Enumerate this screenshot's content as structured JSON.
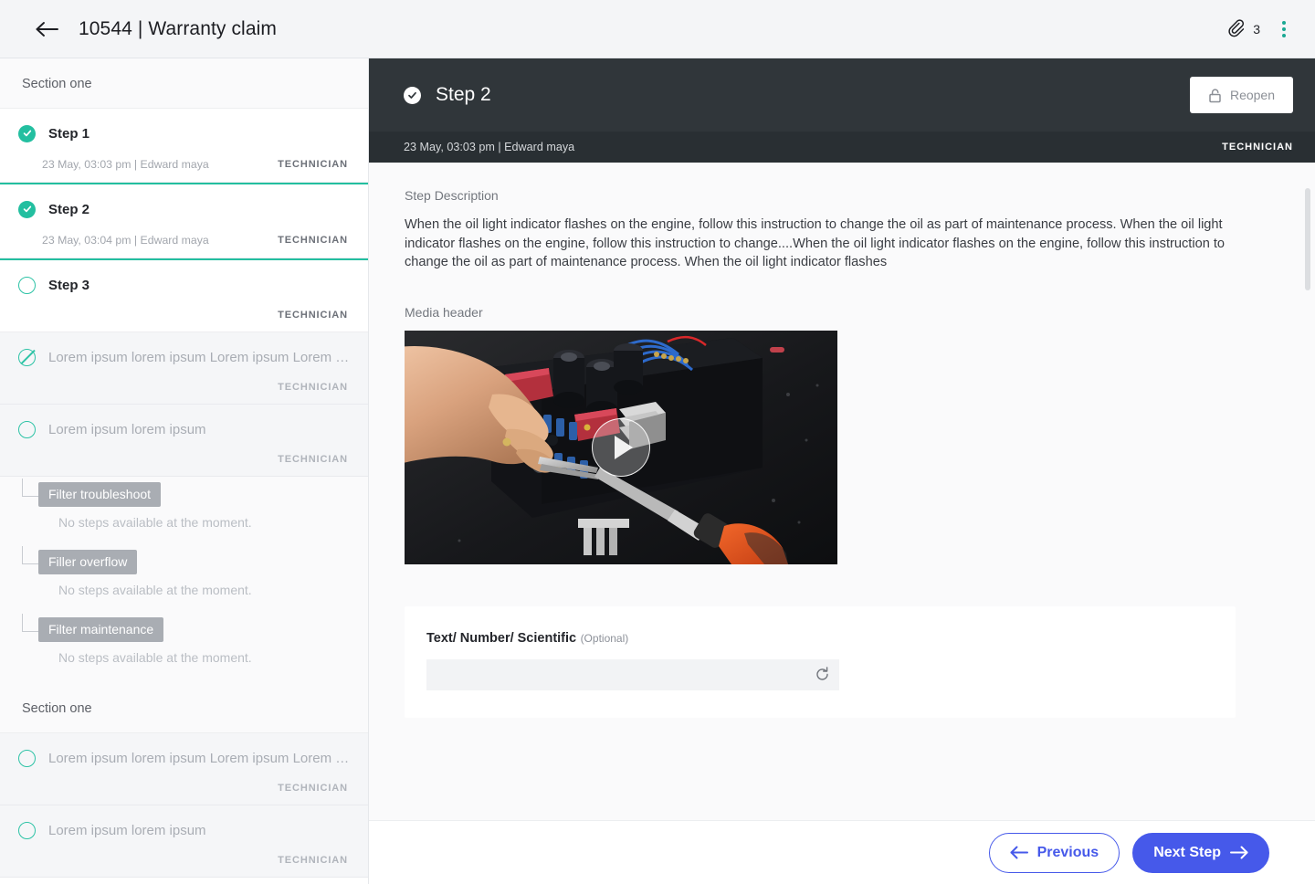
{
  "topbar": {
    "back_icon": "arrow-left-icon",
    "title": "10544 | Warranty claim",
    "attachment_icon": "paperclip-icon",
    "attachment_count": "3",
    "menu_icon": "kebab-menu-icon"
  },
  "sidebar": {
    "sections": [
      {
        "title": "Section one",
        "steps": [
          {
            "status": "done",
            "label": "Step 1",
            "meta": "23 May, 03:03 pm | Edward maya",
            "role": "TECHNICIAN",
            "active": false,
            "muted": false
          },
          {
            "status": "done",
            "label": "Step 2",
            "meta": "23 May, 03:04 pm | Edward maya",
            "role": "TECHNICIAN",
            "active": true,
            "muted": false
          },
          {
            "status": "open",
            "label": "Step 3",
            "meta": "",
            "role": "TECHNICIAN",
            "active": false,
            "muted": false
          },
          {
            "status": "skip",
            "label": "Lorem ipsum lorem ipsum Lorem ipsum Lorem ipsum lor...",
            "meta": "",
            "role": "TECHNICIAN",
            "active": false,
            "muted": true
          },
          {
            "status": "open",
            "label": "Lorem ipsum lorem ipsum",
            "meta": "",
            "role": "TECHNICIAN",
            "active": false,
            "muted": true
          }
        ],
        "filters": [
          {
            "tag": "Filter troubleshoot",
            "empty": "No steps available at the moment."
          },
          {
            "tag": "Filler overflow",
            "empty": "No steps available at the moment."
          },
          {
            "tag": "Filter maintenance",
            "empty": "No steps available at the moment."
          }
        ]
      },
      {
        "title": "Section one",
        "steps": [
          {
            "status": "open",
            "label": "Lorem ipsum lorem ipsum Lorem ipsum Lorem ipsum lor...",
            "meta": "",
            "role": "TECHNICIAN",
            "active": false,
            "muted": true
          },
          {
            "status": "open",
            "label": "Lorem ipsum lorem ipsum",
            "meta": "",
            "role": "TECHNICIAN",
            "active": false,
            "muted": true
          }
        ],
        "filters": []
      }
    ]
  },
  "step_panel": {
    "status_icon": "check-circle-icon",
    "title": "Step 2",
    "reopen_label": "Reopen",
    "reopen_icon": "unlock-icon",
    "timestamp": "23 May, 03:03 pm | Edward maya",
    "role": "TECHNICIAN"
  },
  "main": {
    "description_label": "Step Description",
    "description_text": "When the oil light indicator flashes on the engine, follow this instruction to change the oil as part of maintenance process. When the oil light indicator flashes on the engine, follow this instruction to change....When the oil light indicator flashes on the engine, follow this instruction to change the oil as part of maintenance process. When the oil light indicator flashes",
    "media_label": "Media header",
    "play_icon": "play-button-icon",
    "form": {
      "label": "Text/ Number/ Scientific",
      "optional": "(Optional)",
      "value": "",
      "placeholder": "",
      "refresh_icon": "refresh-icon"
    }
  },
  "footer": {
    "previous_label": "Previous",
    "previous_icon": "arrow-left-icon",
    "next_label": "Next Step",
    "next_icon": "arrow-right-icon"
  },
  "colors": {
    "accent_teal": "#23bfa0",
    "accent_blue": "#4659ea",
    "header_dark": "#30363a",
    "subheader_dark": "#292f33",
    "tag_grey": "#a9adb3"
  }
}
